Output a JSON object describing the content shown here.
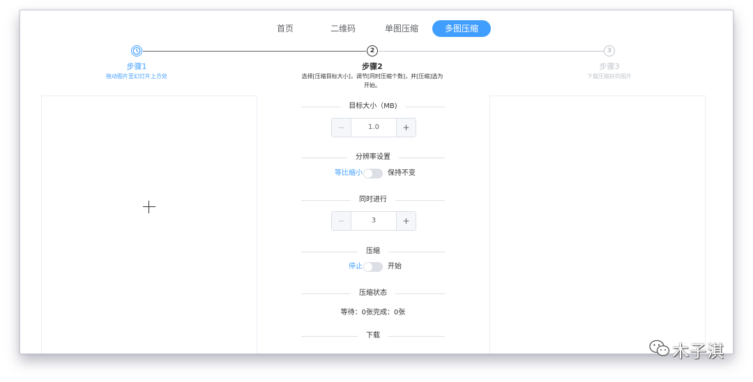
{
  "nav": {
    "items": [
      "首页",
      "二维码",
      "单图压缩",
      "多图压缩"
    ],
    "active_index": 3
  },
  "steps": [
    {
      "icon": "clock-icon",
      "title": "步骤1",
      "desc": "拖动图片至幻灯片上方处",
      "state": "process"
    },
    {
      "number": "2",
      "title": "步骤2",
      "desc_line1": "选择[压缩目标大小]，调节[同时压缩个数]，并[压缩]选为",
      "desc_line2": "开始。",
      "state": "current"
    },
    {
      "number": "3",
      "title": "步骤3",
      "desc": "下载压缩好的图片",
      "state": "wait"
    }
  ],
  "upload": {
    "icon": "plus-icon"
  },
  "settings": {
    "target_size": {
      "label": "目标大小（MB)",
      "value": "1.0",
      "minus": "−",
      "plus": "+"
    },
    "resolution": {
      "label": "分辨率设置",
      "left": "等比缩小",
      "right": "保持不变"
    },
    "concurrency": {
      "label": "同时进行",
      "value": "3",
      "minus": "−",
      "plus": "+"
    },
    "compress": {
      "label": "压缩",
      "left": "停止",
      "right": "开始"
    },
    "status": {
      "label": "压缩状态",
      "text": "等待：0张完成：0张"
    },
    "download": {
      "label": "下载"
    }
  },
  "watermark": {
    "text": "木子淇",
    "icon": "wechat-icon"
  },
  "colors": {
    "accent": "#409eff",
    "step_done": "#409eff",
    "step_wait": "#c0c4cc",
    "text": "#303133"
  }
}
